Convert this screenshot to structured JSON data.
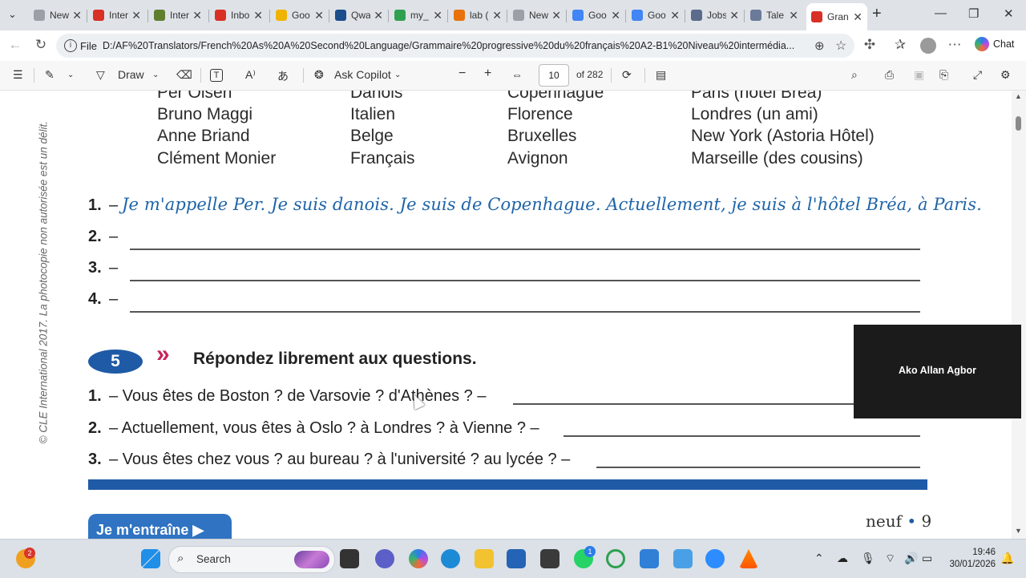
{
  "tabs": [
    {
      "label": "New",
      "color": "#9aa0a6"
    },
    {
      "label": "Inter",
      "color": "#d93025"
    },
    {
      "label": "Inter",
      "color": "#5f7f2f"
    },
    {
      "label": "Inbo",
      "color": "#d93025"
    },
    {
      "label": "Goo",
      "color": "#f0b400"
    },
    {
      "label": "Qwa",
      "color": "#1b4d8c"
    },
    {
      "label": "my_",
      "color": "#2ea04f"
    },
    {
      "label": "lab (",
      "color": "#e8710a"
    },
    {
      "label": "New",
      "color": "#9aa0a6"
    },
    {
      "label": "Goo",
      "color": "#4285f4"
    },
    {
      "label": "Goo",
      "color": "#4285f4"
    },
    {
      "label": "Jobs",
      "color": "#5a6b8c"
    },
    {
      "label": "Tale",
      "color": "#6b7a99"
    },
    {
      "label": "Gran",
      "color": "#d93025",
      "active": true
    }
  ],
  "address": {
    "scheme_label": "File",
    "url": "D:/AF%20Translators/French%20As%20A%20Second%20Language/Grammaire%20progressive%20du%20français%20A2-B1%20Niveau%20intermédia..."
  },
  "chat_label": "Chat",
  "pdf_toolbar": {
    "draw_label": "Draw",
    "copilot_label": "Ask Copilot",
    "page_current": "10",
    "page_total": "of 282"
  },
  "document": {
    "copyright_vertical": "© CLE International 2017. La photocopie non autorisée est un délit.",
    "table_rows": [
      [
        "Per Olsen",
        "Danois",
        "Copenhague",
        "Paris (hôtel Bréa)"
      ],
      [
        "Bruno Maggi",
        "Italien",
        "Florence",
        "Londres (un ami)"
      ],
      [
        "Anne Briand",
        "Belge",
        "Bruxelles",
        "New York (Astoria Hôtel)"
      ],
      [
        "Clément Monier",
        "Français",
        "Avignon",
        "Marseille (des cousins)"
      ]
    ],
    "exercise4": {
      "numbers": [
        "1.",
        "2.",
        "3.",
        "4."
      ],
      "dash": "–",
      "answer1": "Je m'appelle Per. Je suis danois. Je suis de Copenhague. Actuellement, je suis à l'hôtel Bréa, à Paris."
    },
    "exercise5": {
      "number": "5",
      "chevron": "»",
      "title": "Répondez librement aux questions.",
      "questions": [
        {
          "num": "1.",
          "text": "– Vous êtes de Boston ? de Varsovie ? d'Athènes ? –"
        },
        {
          "num": "2.",
          "text": "– Actuellement, vous êtes à Oslo ? à Londres ? à Vienne ? –"
        },
        {
          "num": "3.",
          "text": "– Vous êtes chez vous ? au bureau ? à l'université ? au lycée ? –"
        }
      ]
    },
    "entraine_label": "Je m'entraîne ▶",
    "page_word": "neuf",
    "page_dot": "•",
    "page_number": "9"
  },
  "video_participant": "Ako Allan Agbor",
  "taskbar": {
    "search_label": "Search",
    "notification_badge": "2",
    "whatsapp_badge": "1",
    "time": "19:46",
    "date": "30/01/2026"
  }
}
